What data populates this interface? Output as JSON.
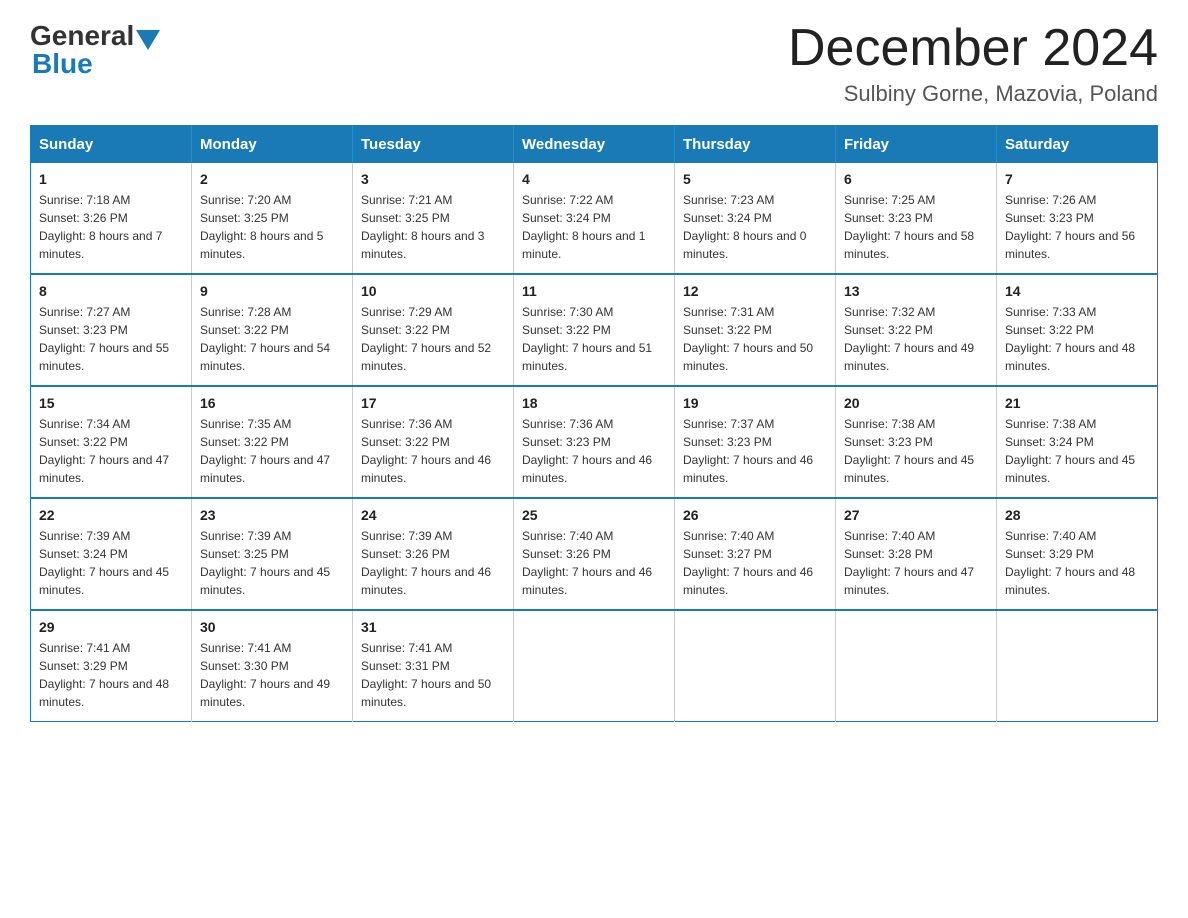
{
  "header": {
    "logo_general": "General",
    "logo_blue": "Blue",
    "month_title": "December 2024",
    "location": "Sulbiny Gorne, Mazovia, Poland"
  },
  "days_of_week": [
    "Sunday",
    "Monday",
    "Tuesday",
    "Wednesday",
    "Thursday",
    "Friday",
    "Saturday"
  ],
  "weeks": [
    [
      {
        "day": "1",
        "sunrise": "7:18 AM",
        "sunset": "3:26 PM",
        "daylight": "8 hours and 7 minutes."
      },
      {
        "day": "2",
        "sunrise": "7:20 AM",
        "sunset": "3:25 PM",
        "daylight": "8 hours and 5 minutes."
      },
      {
        "day": "3",
        "sunrise": "7:21 AM",
        "sunset": "3:25 PM",
        "daylight": "8 hours and 3 minutes."
      },
      {
        "day": "4",
        "sunrise": "7:22 AM",
        "sunset": "3:24 PM",
        "daylight": "8 hours and 1 minute."
      },
      {
        "day": "5",
        "sunrise": "7:23 AM",
        "sunset": "3:24 PM",
        "daylight": "8 hours and 0 minutes."
      },
      {
        "day": "6",
        "sunrise": "7:25 AM",
        "sunset": "3:23 PM",
        "daylight": "7 hours and 58 minutes."
      },
      {
        "day": "7",
        "sunrise": "7:26 AM",
        "sunset": "3:23 PM",
        "daylight": "7 hours and 56 minutes."
      }
    ],
    [
      {
        "day": "8",
        "sunrise": "7:27 AM",
        "sunset": "3:23 PM",
        "daylight": "7 hours and 55 minutes."
      },
      {
        "day": "9",
        "sunrise": "7:28 AM",
        "sunset": "3:22 PM",
        "daylight": "7 hours and 54 minutes."
      },
      {
        "day": "10",
        "sunrise": "7:29 AM",
        "sunset": "3:22 PM",
        "daylight": "7 hours and 52 minutes."
      },
      {
        "day": "11",
        "sunrise": "7:30 AM",
        "sunset": "3:22 PM",
        "daylight": "7 hours and 51 minutes."
      },
      {
        "day": "12",
        "sunrise": "7:31 AM",
        "sunset": "3:22 PM",
        "daylight": "7 hours and 50 minutes."
      },
      {
        "day": "13",
        "sunrise": "7:32 AM",
        "sunset": "3:22 PM",
        "daylight": "7 hours and 49 minutes."
      },
      {
        "day": "14",
        "sunrise": "7:33 AM",
        "sunset": "3:22 PM",
        "daylight": "7 hours and 48 minutes."
      }
    ],
    [
      {
        "day": "15",
        "sunrise": "7:34 AM",
        "sunset": "3:22 PM",
        "daylight": "7 hours and 47 minutes."
      },
      {
        "day": "16",
        "sunrise": "7:35 AM",
        "sunset": "3:22 PM",
        "daylight": "7 hours and 47 minutes."
      },
      {
        "day": "17",
        "sunrise": "7:36 AM",
        "sunset": "3:22 PM",
        "daylight": "7 hours and 46 minutes."
      },
      {
        "day": "18",
        "sunrise": "7:36 AM",
        "sunset": "3:23 PM",
        "daylight": "7 hours and 46 minutes."
      },
      {
        "day": "19",
        "sunrise": "7:37 AM",
        "sunset": "3:23 PM",
        "daylight": "7 hours and 46 minutes."
      },
      {
        "day": "20",
        "sunrise": "7:38 AM",
        "sunset": "3:23 PM",
        "daylight": "7 hours and 45 minutes."
      },
      {
        "day": "21",
        "sunrise": "7:38 AM",
        "sunset": "3:24 PM",
        "daylight": "7 hours and 45 minutes."
      }
    ],
    [
      {
        "day": "22",
        "sunrise": "7:39 AM",
        "sunset": "3:24 PM",
        "daylight": "7 hours and 45 minutes."
      },
      {
        "day": "23",
        "sunrise": "7:39 AM",
        "sunset": "3:25 PM",
        "daylight": "7 hours and 45 minutes."
      },
      {
        "day": "24",
        "sunrise": "7:39 AM",
        "sunset": "3:26 PM",
        "daylight": "7 hours and 46 minutes."
      },
      {
        "day": "25",
        "sunrise": "7:40 AM",
        "sunset": "3:26 PM",
        "daylight": "7 hours and 46 minutes."
      },
      {
        "day": "26",
        "sunrise": "7:40 AM",
        "sunset": "3:27 PM",
        "daylight": "7 hours and 46 minutes."
      },
      {
        "day": "27",
        "sunrise": "7:40 AM",
        "sunset": "3:28 PM",
        "daylight": "7 hours and 47 minutes."
      },
      {
        "day": "28",
        "sunrise": "7:40 AM",
        "sunset": "3:29 PM",
        "daylight": "7 hours and 48 minutes."
      }
    ],
    [
      {
        "day": "29",
        "sunrise": "7:41 AM",
        "sunset": "3:29 PM",
        "daylight": "7 hours and 48 minutes."
      },
      {
        "day": "30",
        "sunrise": "7:41 AM",
        "sunset": "3:30 PM",
        "daylight": "7 hours and 49 minutes."
      },
      {
        "day": "31",
        "sunrise": "7:41 AM",
        "sunset": "3:31 PM",
        "daylight": "7 hours and 50 minutes."
      },
      null,
      null,
      null,
      null
    ]
  ],
  "labels": {
    "sunrise": "Sunrise:",
    "sunset": "Sunset:",
    "daylight": "Daylight:"
  }
}
